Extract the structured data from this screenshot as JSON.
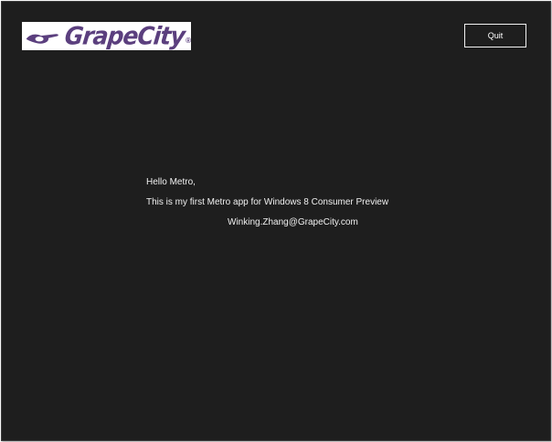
{
  "header": {
    "logo": {
      "text": "GrapeCity",
      "registered": "®",
      "color": "#5b3f7e"
    },
    "quit_label": "Quit"
  },
  "content": {
    "greeting": "Hello Metro,",
    "message": "This is my first Metro app for Windows 8 Consumer Preview",
    "signature": "Winking.Zhang@GrapeCity.com"
  },
  "colors": {
    "background": "#1e1e1e",
    "text": "#f0f0f0",
    "brand": "#5b3f7e"
  }
}
